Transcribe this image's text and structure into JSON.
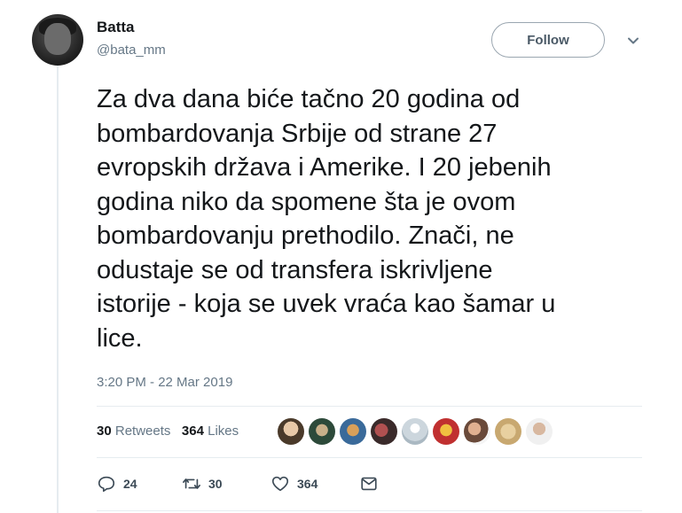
{
  "user": {
    "name": "Batta",
    "handle": "@bata_mm"
  },
  "follow_button": {
    "label": "Follow"
  },
  "tweet": {
    "text": "Za dva dana biće tačno 20 godina od\nbombardovanja Srbije od strane 27\nevropskih država i Amerike. I 20 jebenih\ngodina niko da spomene šta je ovom\nbombardovanju prethodilo. Znači, ne\nodustaje se od transfera iskrivljene\nistorije - koja se uvek vraća kao šamar u\nlice.",
    "timestamp": "3:20 PM - 22 Mar 2019"
  },
  "stats": {
    "retweets_count": "30",
    "retweets_label": "Retweets",
    "likes_count": "364",
    "likes_label": "Likes"
  },
  "actions": {
    "reply_count": "24",
    "retweet_count": "30",
    "like_count": "364"
  },
  "icons": {
    "caret": "chevron-down-icon",
    "reply": "reply-icon",
    "retweet": "retweet-icon",
    "like": "heart-icon",
    "dm": "envelope-icon"
  },
  "colors": {
    "secondary_text": "#657786",
    "primary_text": "#14171a",
    "divider": "#e6ecf0"
  }
}
